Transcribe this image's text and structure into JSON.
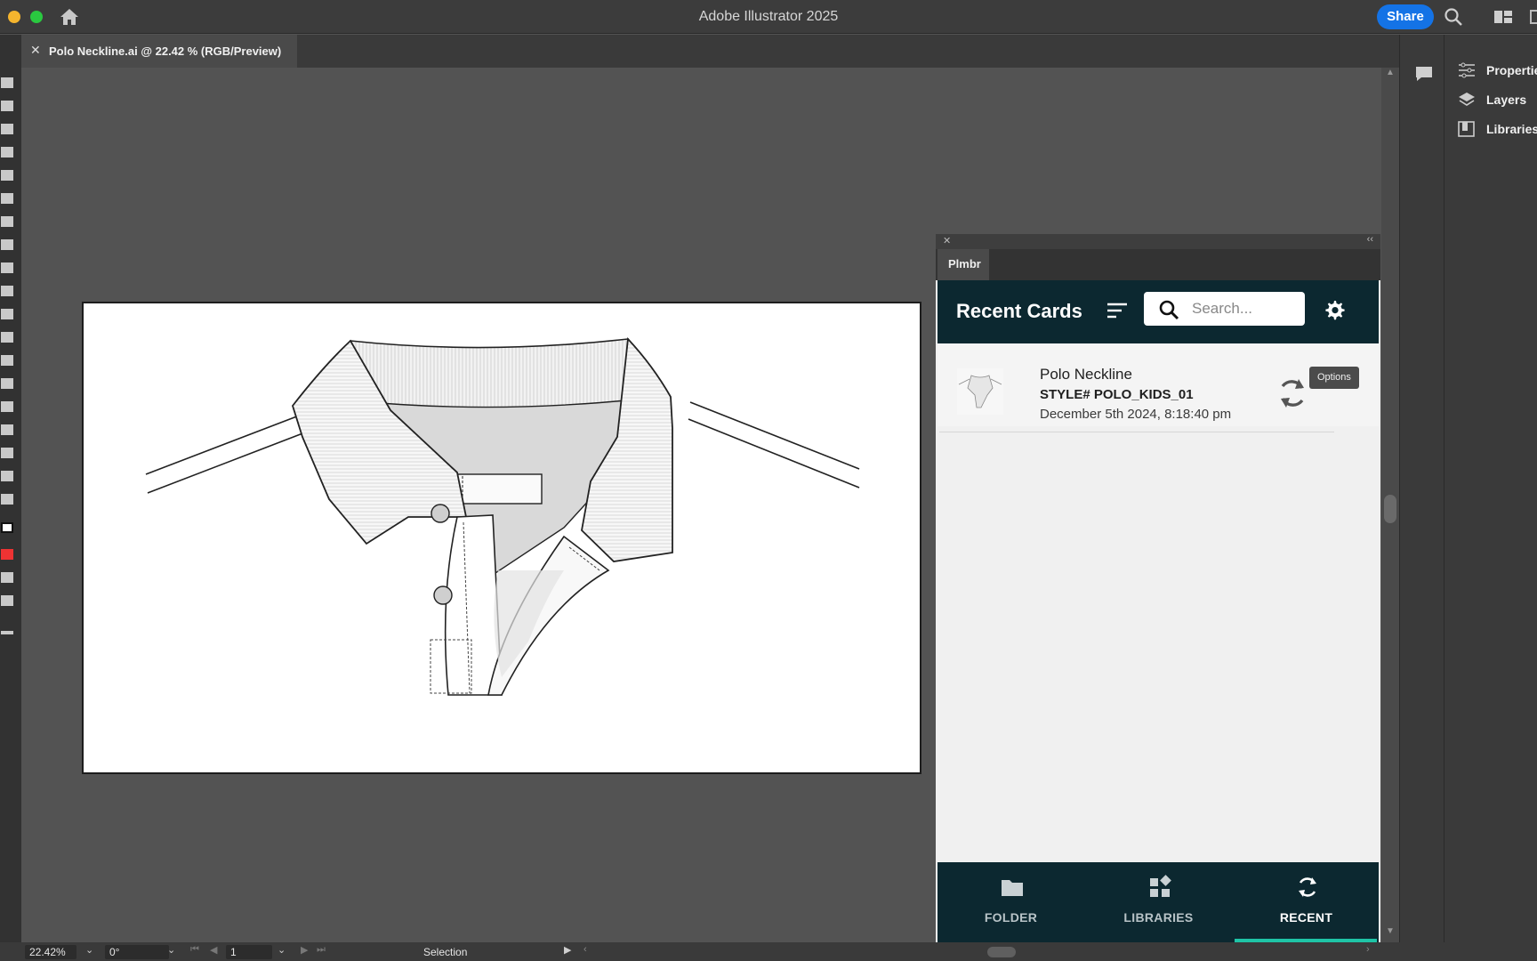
{
  "window": {
    "app_title": "Adobe Illustrator 2025",
    "share_label": "Share"
  },
  "document_tab": {
    "close_glyph": "✕",
    "label": "Polo Neckline.ai @ 22.42 % (RGB/Preview)"
  },
  "right_panel": {
    "items": [
      {
        "label": "Properties",
        "icon": "properties-icon"
      },
      {
        "label": "Layers",
        "icon": "layers-icon"
      },
      {
        "label": "Libraries",
        "icon": "libraries-icon"
      }
    ]
  },
  "plmbr": {
    "close_glyph": "✕",
    "collapse_glyph": "‹‹",
    "tab_label": "Plmbr",
    "header_title": "Recent Cards",
    "search_placeholder": "Search...",
    "tooltip": "Options",
    "card": {
      "name": "Polo Neckline",
      "style": "STYLE# POLO_KIDS_01",
      "date": "December 5th 2024, 8:18:40 pm"
    },
    "nav": [
      {
        "label": "FOLDER",
        "icon": "folder-icon",
        "active": false
      },
      {
        "label": "LIBRARIES",
        "icon": "libraries-grid-icon",
        "active": false
      },
      {
        "label": "RECENT",
        "icon": "sync-icon",
        "active": true
      }
    ],
    "colors": {
      "header_bg": "#0c2830",
      "accent": "#1fc4a6"
    }
  },
  "statusbar": {
    "zoom": "22.42%",
    "rotation": "0°",
    "artboard": "1",
    "tool": "Selection"
  },
  "colors": {
    "share_blue": "#1473e6",
    "canvas_bg": "#535353"
  }
}
